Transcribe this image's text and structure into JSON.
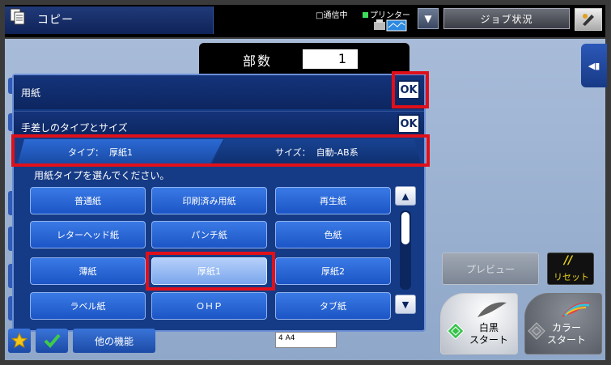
{
  "header": {
    "app_title": "コピー",
    "status_comm": "□通信中",
    "status_printer": "プリンター",
    "job_status_label": "ジョブ状況"
  },
  "copies": {
    "label": "部数",
    "value": "1"
  },
  "dialog": {
    "paper_label": "用紙",
    "ok_label": "OK",
    "bypass_label": "手差しのタイプとサイズ",
    "tab_type": "タイプ：  厚紙1",
    "tab_size": "サイズ：  自動-AB系",
    "instruction": "用紙タイプを選んでください。",
    "paper_types": [
      [
        "普通紙",
        "印刷済み用紙",
        "再生紙"
      ],
      [
        "レターヘッド紙",
        "パンチ紙",
        "色紙"
      ],
      [
        "薄紙",
        "厚紙1",
        "厚紙2"
      ],
      [
        "ラベル紙",
        "ＯＨＰ",
        "タブ紙"
      ]
    ],
    "selected": "厚紙1"
  },
  "bottom": {
    "more_functions": "他の機能",
    "tray_text": "4  A4",
    "preview": "プレビュー",
    "reset_slash": "//",
    "reset": "リセット",
    "mono_start": "白黒\nスタート",
    "color_start": "カラー\nスタート"
  },
  "colors": {
    "highlight": "#e0101a",
    "dialog_bg": "#163b86",
    "button_blue": "#1c55c6",
    "selected_button": "#7aa6ec"
  },
  "icons": [
    "copy-icon",
    "printer-icon",
    "help-icon",
    "star-icon",
    "check-icon",
    "collapse-icon",
    "start-diamond-icon",
    "feather-icon"
  ]
}
